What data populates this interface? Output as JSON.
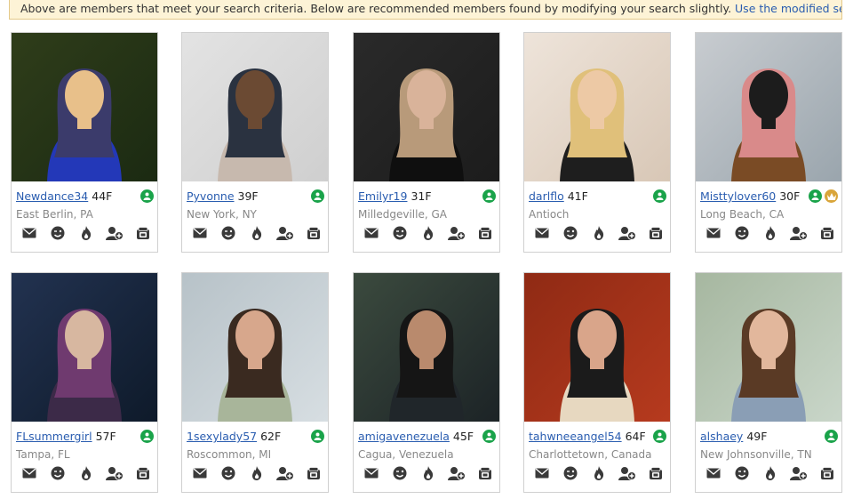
{
  "notice": {
    "text": "Above are members that meet your search criteria. Below are recommended members found by modifying your search slightly. ",
    "link": "Use the modified search criteria",
    "end": "."
  },
  "members": [
    {
      "username": "Newdance34",
      "age": "44F",
      "location": "East Berlin, PA",
      "online": true,
      "premium": false,
      "palette": [
        "#1b2a12",
        "#2f3d1a",
        "#2338b8",
        "#e8c08a",
        "#3b3b6b"
      ]
    },
    {
      "username": "Pyvonne",
      "age": "39F",
      "location": "New York, NY",
      "online": true,
      "premium": false,
      "palette": [
        "#cfcfcf",
        "#e3e3e3",
        "#c7b9ae",
        "#6b4a33",
        "#2a3240"
      ]
    },
    {
      "username": "Emilyr19",
      "age": "31F",
      "location": "Milledgeville, GA",
      "online": true,
      "premium": false,
      "palette": [
        "#1c1c1c",
        "#2a2a2a",
        "#0f0f0f",
        "#d9b39a",
        "#b89a7a"
      ]
    },
    {
      "username": "darlflo",
      "age": "41F",
      "location": "Antioch",
      "online": true,
      "premium": false,
      "palette": [
        "#d8c7b6",
        "#eee4da",
        "#1e1e1e",
        "#edc9a5",
        "#e0c07a"
      ]
    },
    {
      "username": "Misttylover60",
      "age": "30F",
      "location": "Long Beach, CA",
      "online": true,
      "premium": true,
      "palette": [
        "#9aa5ad",
        "#c8ccd0",
        "#7a4b25",
        "#1c1c1c",
        "#d98a8a"
      ]
    },
    {
      "username": "FLsummergirl",
      "age": "57F",
      "location": "Tampa, FL",
      "online": true,
      "premium": false,
      "palette": [
        "#0e1a2a",
        "#223250",
        "#3c2a48",
        "#d7b7a0",
        "#6f3a6f"
      ]
    },
    {
      "username": "1sexylady57",
      "age": "62F",
      "location": "Roscommon, MI",
      "online": true,
      "premium": false,
      "palette": [
        "#d7dee2",
        "#b7c2c8",
        "#a8b59a",
        "#d7a78c",
        "#3a2a20"
      ]
    },
    {
      "username": "amigavenezuela",
      "age": "45F",
      "location": "Cagua, Venezuela",
      "online": true,
      "premium": false,
      "palette": [
        "#1c2326",
        "#3b4a3e",
        "#20262a",
        "#b98a6d",
        "#151515"
      ]
    },
    {
      "username": "tahwneeangel54",
      "age": "64F",
      "location": "Charlottetown, Canada",
      "online": true,
      "premium": false,
      "palette": [
        "#b63a1e",
        "#8f2a14",
        "#e7d8c0",
        "#d9a58a",
        "#1b1b1b"
      ]
    },
    {
      "username": "alshaey",
      "age": "49F",
      "location": "New Johnsonville, TN",
      "online": true,
      "premium": false,
      "palette": [
        "#c9d6c9",
        "#a6b7a0",
        "#8a9eb5",
        "#e2b79c",
        "#5a3a25"
      ]
    }
  ],
  "actions": [
    "envelope-icon",
    "wink-icon",
    "flame-icon",
    "add-favorite-icon",
    "gift-icon"
  ]
}
